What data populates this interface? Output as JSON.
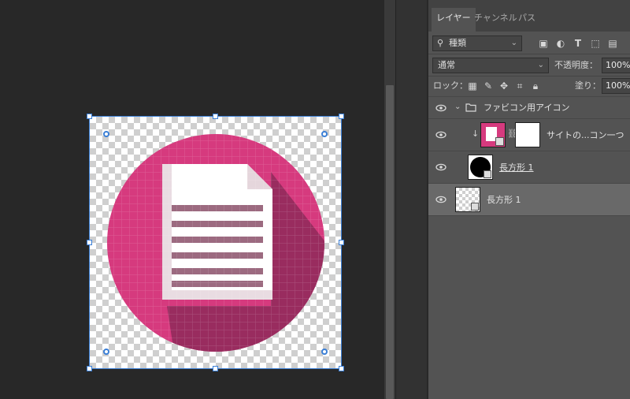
{
  "tabs": [
    {
      "label": "レイヤー",
      "active": true
    },
    {
      "label": "チャンネル",
      "active": false
    },
    {
      "label": "パス",
      "active": false
    }
  ],
  "filter": {
    "kind_label": "種類"
  },
  "blend": {
    "mode": "通常",
    "opacity_label": "不透明度：",
    "opacity_value": "100%"
  },
  "lock": {
    "label": "ロック：",
    "fill_label": "塗り：",
    "fill_value": "100%"
  },
  "layers": [
    {
      "name": "ファビコン用アイコン",
      "type": "group"
    },
    {
      "name": "サイトの...コン一つ",
      "type": "smart-masked"
    },
    {
      "name": "長方形 1",
      "type": "shape"
    },
    {
      "name": "長方形 1",
      "type": "shape",
      "selected": true
    }
  ],
  "icon_colors": {
    "circle": "#d63a7e",
    "shadow": "#9e2f63",
    "paper": "#ffffff",
    "lines": "#c8a4b3",
    "accent": "#3b7fd6"
  }
}
